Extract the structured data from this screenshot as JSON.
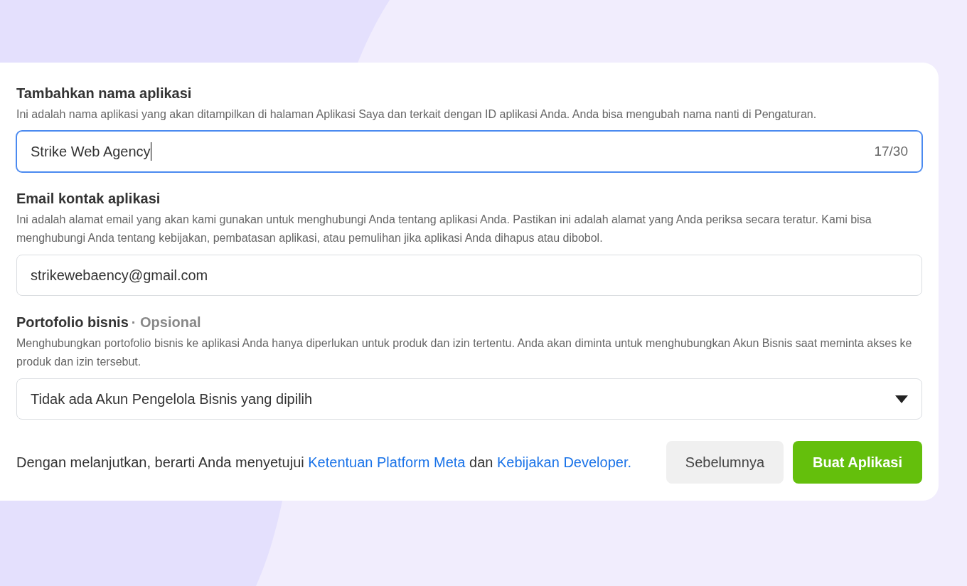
{
  "fields": [
    {
      "kind": "text",
      "label": "Tambahkan nama aplikasi",
      "description": "Ini adalah nama aplikasi yang akan ditampilkan di halaman Aplikasi Saya dan terkait dengan ID aplikasi Anda. Anda bisa mengubah nama nanti di Pengaturan.",
      "value": "Strike Web Agency",
      "counter": "17/30",
      "focused": true
    },
    {
      "kind": "text",
      "label": "Email kontak aplikasi",
      "description": "Ini adalah alamat email yang akan kami gunakan untuk menghubungi Anda tentang aplikasi Anda. Pastikan ini adalah alamat yang Anda periksa secara teratur. Kami bisa menghubungi Anda tentang kebijakan, pembatasan aplikasi, atau pemulihan jika aplikasi Anda dihapus atau dibobol.",
      "value": "strikewebaency@gmail.com",
      "focused": false
    },
    {
      "kind": "select",
      "label": "Portofolio bisnis",
      "optional": "· Opsional",
      "description": "Menghubungkan portofolio bisnis ke aplikasi Anda hanya diperlukan untuk produk dan izin tertentu. Anda akan diminta untuk menghubungkan Akun Bisnis saat meminta akses ke produk dan izin tersebut.",
      "value": "Tidak ada Akun Pengelola Bisnis yang dipilih",
      "focused": false
    }
  ],
  "terms": {
    "text_1": "Dengan melanjutkan, berarti Anda menyetujui",
    "link_1": "Ketentuan Platform Meta",
    "text_2": "dan",
    "link_2": "Kebijakan Developer."
  },
  "buttons": [
    {
      "kind": "secondary",
      "label": "Sebelumnya"
    },
    {
      "kind": "primary",
      "label": "Buat Aplikasi"
    }
  ]
}
